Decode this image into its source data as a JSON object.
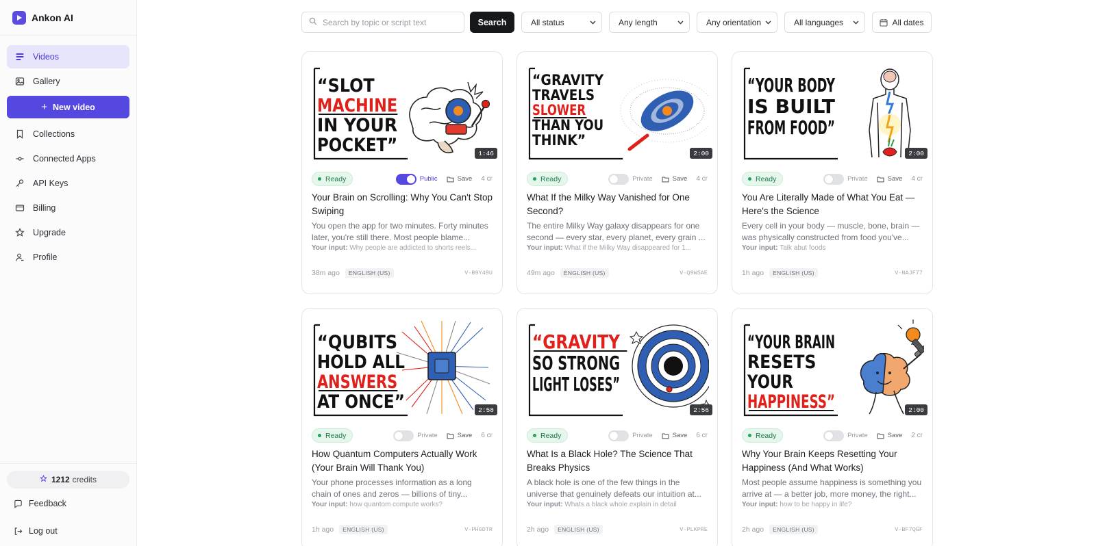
{
  "app": {
    "name": "Ankon AI"
  },
  "sidebar": {
    "items": [
      {
        "label": "Videos",
        "icon": "videos-icon",
        "active": true
      },
      {
        "label": "Gallery",
        "icon": "image-icon"
      },
      {
        "label": "Collections",
        "icon": "bookmark-icon"
      },
      {
        "label": "Connected Apps",
        "icon": "connected-apps-icon"
      },
      {
        "label": "API Keys",
        "icon": "key-icon"
      },
      {
        "label": "Billing",
        "icon": "credit-card-icon"
      },
      {
        "label": "Upgrade",
        "icon": "star-icon"
      },
      {
        "label": "Profile",
        "icon": "user-icon"
      }
    ],
    "new_video_label": "New video",
    "credits_value": "1212",
    "credits_label": "credits",
    "feedback_label": "Feedback",
    "logout_label": "Log out"
  },
  "filters": {
    "search_placeholder": "Search by topic or script text",
    "search_button": "Search",
    "status": "All status",
    "length": "Any length",
    "orientation": "Any orientation",
    "language": "All languages",
    "dates": "All dates"
  },
  "colors": {
    "accent": "#5548e0",
    "ready_bg": "#e5f6ec",
    "ready_text": "#1f7a45",
    "headline_red": "#e0201b"
  },
  "videos": [
    {
      "thumb_lines": [
        "“SLOT",
        "MACHINE",
        "IN YOUR",
        "POCKET”"
      ],
      "thumb_red": "MACHINE",
      "thumb_art": "brain-slot-machine",
      "duration": "1:46",
      "status": "Ready",
      "visibility": "Public",
      "public": true,
      "save": "Save",
      "cost": "4 cr",
      "title": "Your Brain on Scrolling: Why You Can't Stop Swiping",
      "description": "You open the app for two minutes. Forty minutes later, you're still there. Most people blame...",
      "input_label": "Your input:",
      "input_text": "Why people are addicted to shorts reels...",
      "time": "38m ago",
      "language": "ENGLISH (US)",
      "id": "V-B9Y49U"
    },
    {
      "thumb_lines": [
        "“GRAVITY",
        "TRAVELS",
        "SLOWER",
        "THAN YOU",
        "THINK”"
      ],
      "thumb_red": "SLOWER",
      "thumb_art": "galaxy",
      "duration": "2:00",
      "status": "Ready",
      "visibility": "Private",
      "public": false,
      "save": "Save",
      "cost": "4 cr",
      "title": "What If the Milky Way Vanished for One Second?",
      "description": "The entire Milky Way galaxy disappears for one second — every star, every planet, every grain ...",
      "input_label": "Your input:",
      "input_text": "What if the Milky Way disappeared for 1...",
      "time": "49m ago",
      "language": "ENGLISH (US)",
      "id": "V-Q9WSAE"
    },
    {
      "thumb_lines": [
        "“YOUR BODY",
        "IS BUILT",
        "FROM FOOD”"
      ],
      "thumb_red": "BUILT",
      "thumb_art": "human-body",
      "duration": "2:00",
      "status": "Ready",
      "visibility": "Private",
      "public": false,
      "save": "Save",
      "cost": "4 cr",
      "title": "You Are Literally Made of What You Eat — Here's the Science",
      "description": "Every cell in your body — muscle, bone, brain — was physically constructed from food you've...",
      "input_label": "Your input:",
      "input_text": "Talk abut foods",
      "time": "1h ago",
      "language": "ENGLISH (US)",
      "id": "V-NAJF77"
    },
    {
      "thumb_lines": [
        "“QUBITS",
        "HOLD ALL",
        "ANSWERS",
        "AT ONCE”"
      ],
      "thumb_red": "ANSWERS",
      "thumb_art": "quantum-chip",
      "duration": "2:58",
      "status": "Ready",
      "visibility": "Private",
      "public": false,
      "save": "Save",
      "cost": "6 cr",
      "title": "How Quantum Computers Actually Work (Your Brain Will Thank You)",
      "description": "Your phone processes information as a long chain of ones and zeros — billions of tiny...",
      "input_label": "Your input:",
      "input_text": "how quantom compute works?",
      "time": "1h ago",
      "language": "ENGLISH (US)",
      "id": "V-PH6DTR"
    },
    {
      "thumb_lines": [
        "“GRAVITY",
        "SO STRONG",
        "LIGHT LOSES”"
      ],
      "thumb_red": "GRAVITY",
      "thumb_art": "black-hole",
      "duration": "2:56",
      "status": "Ready",
      "visibility": "Private",
      "public": false,
      "save": "Save",
      "cost": "6 cr",
      "title": "What Is a Black Hole? The Science That Breaks Physics",
      "description": "A black hole is one of the few things in the universe that genuinely defeats our intuition at...",
      "input_label": "Your input:",
      "input_text": "Whats a black whole explain in detail",
      "time": "2h ago",
      "language": "ENGLISH (US)",
      "id": "V-PLKPRE"
    },
    {
      "thumb_lines": [
        "“YOUR BRAIN",
        "RESETS",
        "YOUR",
        "HAPPINESS”"
      ],
      "thumb_red": "HAPPINESS",
      "thumb_art": "brain-dumbbell",
      "duration": "2:00",
      "status": "Ready",
      "visibility": "Private",
      "public": false,
      "save": "Save",
      "cost": "2 cr",
      "title": "Why Your Brain Keeps Resetting Your Happiness (And What Works)",
      "description": "Most people assume happiness is something you arrive at — a better job, more money, the right...",
      "input_label": "Your input:",
      "input_text": "how to be happy in life?",
      "time": "2h ago",
      "language": "ENGLISH (US)",
      "id": "V-BF7QGF"
    }
  ]
}
